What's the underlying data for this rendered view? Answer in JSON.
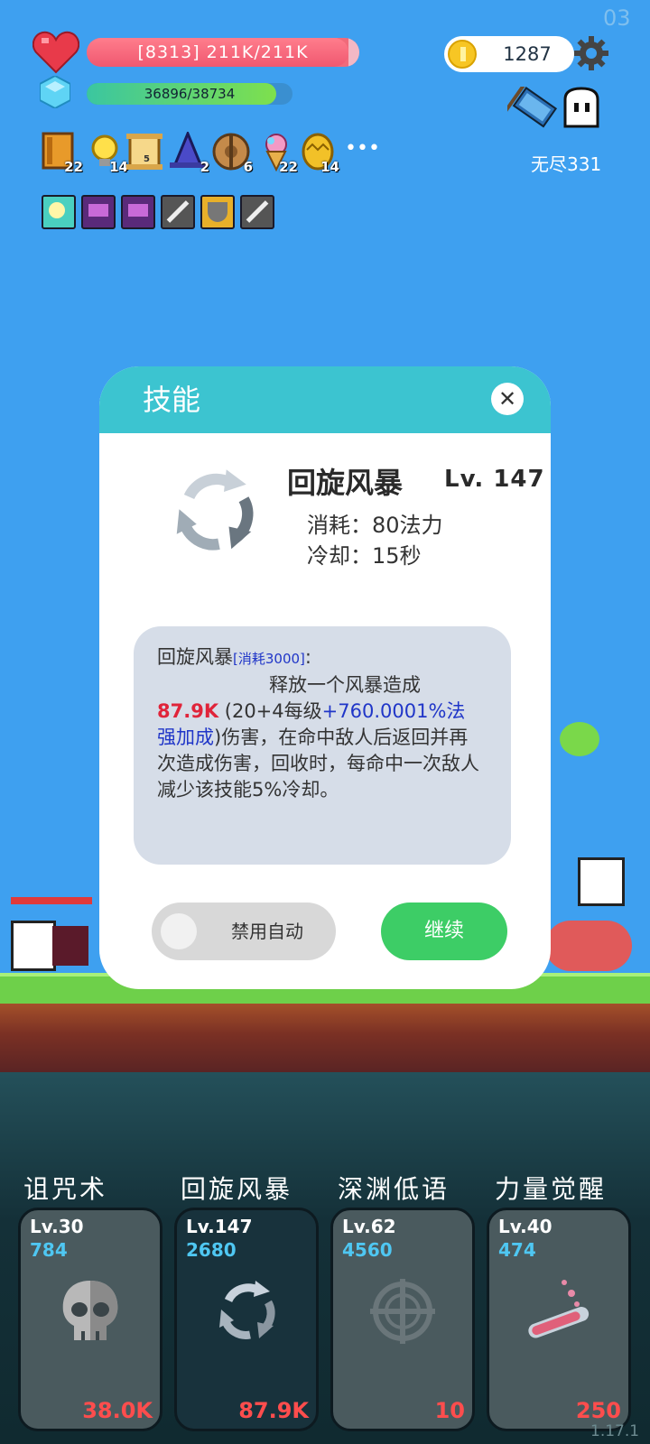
{
  "corner_text": "03",
  "version": "1.17.1",
  "hud": {
    "hp_text": "[8313] 211K/211K",
    "hp_fraction": 1.0,
    "mp_text": "36896/38734",
    "mp_fraction": 0.95,
    "coins": "1287",
    "mode_label": "无尽331"
  },
  "items": [
    {
      "icon": "book-icon",
      "count": "22"
    },
    {
      "icon": "lightbulb-icon",
      "count": "14"
    },
    {
      "icon": "scroll-icon",
      "count": "5"
    },
    {
      "icon": "wizard-hat-icon",
      "count": "2"
    },
    {
      "icon": "wooden-shield-icon",
      "count": "6"
    },
    {
      "icon": "ice-cream-icon",
      "count": "22"
    },
    {
      "icon": "golden-egg-icon",
      "count": "14"
    }
  ],
  "more_label": "•••",
  "buffs": [
    "lightbulb-buff-icon",
    "demon-buff-icon",
    "demon-buff-icon",
    "sword-buff-icon",
    "shield-buff-icon",
    "sword-buff-icon"
  ],
  "modal": {
    "title": "技能",
    "close": "✕",
    "skill_name": "回旋风暴",
    "skill_level": "Lv. 147",
    "cost_line": "消耗：80法力",
    "cooldown_line": "冷却：15秒",
    "desc_name": "回旋风暴",
    "desc_cost_tag": "[消耗3000]",
    "desc_colon": ":",
    "desc_line1": "释放一个风暴造成",
    "desc_damage": "87.9K",
    "desc_formula_a": " (20+4每级",
    "desc_formula_b": "+760.0001%法强加成",
    "desc_formula_c": ")",
    "desc_rest": "伤害，在命中敌人后返回并再次造成伤害，回收时，每命中一次敌人减少该技能5%冷却。",
    "toggle_label": "禁用自动",
    "continue_label": "继续"
  },
  "skills": [
    {
      "name": "诅咒术",
      "level": "Lv.30",
      "cost": "784",
      "value": "38.0K",
      "icon": "skull-icon"
    },
    {
      "name": "回旋风暴",
      "level": "Lv.147",
      "cost": "2680",
      "value": "87.9K",
      "icon": "whirlwind-icon"
    },
    {
      "name": "深渊低语",
      "level": "Lv.62",
      "cost": "4560",
      "value": "10",
      "icon": "crosshair-icon"
    },
    {
      "name": "力量觉醒",
      "level": "Lv.40",
      "cost": "474",
      "value": "250",
      "icon": "potion-tube-icon"
    }
  ],
  "colors": {
    "sky": "#3ea0f0",
    "modal_header": "#3cc4d0",
    "continue_button": "#3dcd66",
    "damage_red": "#e0243a",
    "formula_blue": "#2036c8"
  }
}
